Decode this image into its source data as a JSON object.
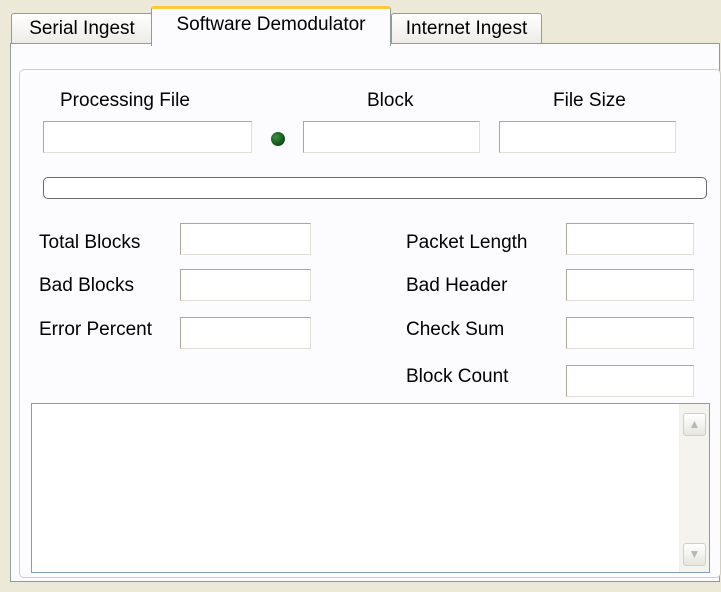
{
  "tabs": [
    {
      "label": "Serial Ingest"
    },
    {
      "label": "Software Demodulator"
    },
    {
      "label": "Internet Ingest"
    }
  ],
  "active_tab": "Software Demodulator",
  "header_labels": {
    "processing_file": "Processing File",
    "block": "Block",
    "file_size": "File Size"
  },
  "fields": {
    "processing_file": "",
    "block": "",
    "file_size": "",
    "total_blocks": "",
    "bad_blocks": "",
    "error_percent": "",
    "packet_length": "",
    "bad_header": "",
    "check_sum": "",
    "block_count": ""
  },
  "stats_labels": {
    "total_blocks": "Total Blocks",
    "bad_blocks": "Bad Blocks",
    "error_percent": "Error Percent",
    "packet_length": "Packet Length",
    "bad_header": "Bad Header",
    "check_sum": "Check Sum",
    "block_count": "Block Count"
  },
  "progress": 0,
  "status_led_color": "#0b4d12",
  "log_text": "",
  "icons": {
    "scroll_up": "▲",
    "scroll_down": "▼"
  }
}
